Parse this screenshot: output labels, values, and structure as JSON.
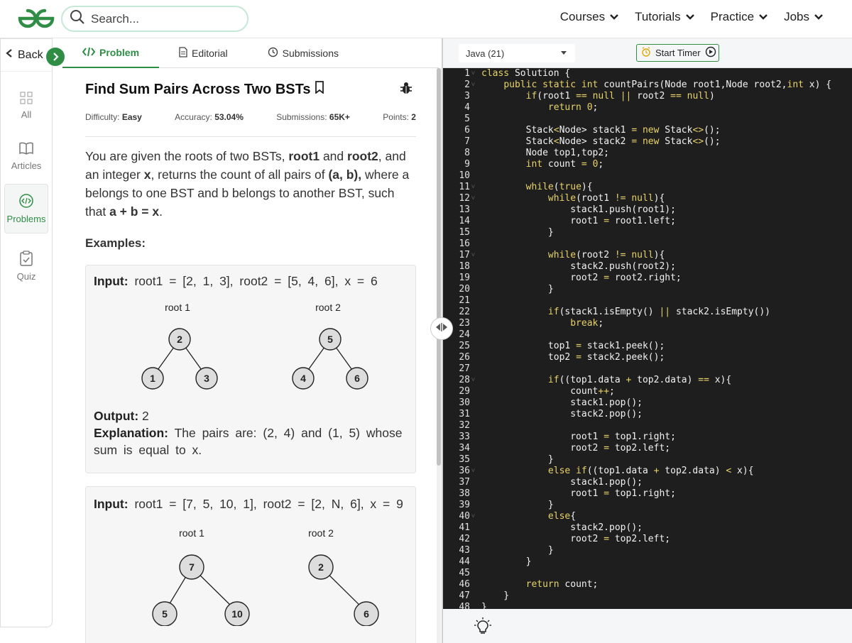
{
  "header": {
    "search_placeholder": "Search...",
    "nav": [
      {
        "label": "Courses"
      },
      {
        "label": "Tutorials"
      },
      {
        "label": "Practice"
      },
      {
        "label": "Jobs"
      }
    ]
  },
  "sidebar": {
    "back_label": "Back",
    "items": [
      {
        "label": "All"
      },
      {
        "label": "Articles"
      },
      {
        "label": "Problems"
      },
      {
        "label": "Quiz"
      }
    ]
  },
  "tabs": [
    {
      "label": "Problem"
    },
    {
      "label": "Editorial"
    },
    {
      "label": "Submissions"
    }
  ],
  "problem": {
    "title": "Find Sum Pairs Across Two BSTs",
    "difficulty_label": "Difficulty:",
    "difficulty": "Easy",
    "accuracy_label": "Accuracy:",
    "accuracy": "53.04%",
    "submissions_label": "Submissions:",
    "submissions": "65K+",
    "points_label": "Points:",
    "points": "2",
    "desc_1": "You are given the roots of two BSTs, ",
    "desc_root1": "root1",
    "desc_2": " and ",
    "desc_root2": "root2",
    "desc_3": ", and an integer ",
    "desc_x": "x",
    "desc_4": ", returns the count of all pairs of ",
    "desc_ab": "(a, b),",
    "desc_5": " where a belongs to one BST and b belongs to another BST, such that ",
    "desc_sum": "a + b = x",
    "desc_6": ".",
    "examples_heading": "Examples:"
  },
  "examples": [
    {
      "input_label": "Input:",
      "input": "root1 = [2, 1, 3], root2 = [5, 4, 6], x = 6",
      "tree1_label": "root 1",
      "tree1": [
        "2",
        "1",
        "3"
      ],
      "tree2_label": "root 2",
      "tree2": [
        "5",
        "4",
        "6"
      ],
      "output_label": "Output:",
      "output": "2",
      "explanation_label": "Explanation:",
      "explanation": "The pairs are: (2, 4) and (1, 5) whose sum is equal to x."
    },
    {
      "input_label": "Input:",
      "input": "root1 = [7, 5, 10, 1], root2 = [2, N, 6], x = 9",
      "tree1_label": "root 1",
      "tree1": [
        "7",
        "5",
        "10"
      ],
      "tree2_label": "root 2",
      "tree2": [
        "2",
        "6"
      ]
    }
  ],
  "editor": {
    "language": "Java (21)",
    "timer_label": "Start Timer",
    "lines": [
      "class Solution {",
      "    public static int countPairs(Node root1,Node root2,int x) {",
      "        if(root1 == null || root2 == null)",
      "            return 0;",
      "",
      "        Stack<Node> stack1 = new Stack<>();",
      "        Stack<Node> stack2 = new Stack<>();",
      "        Node top1,top2;",
      "        int count = 0;",
      "",
      "        while(true){",
      "            while(root1 != null){",
      "                stack1.push(root1);",
      "                root1 = root1.left;",
      "            }",
      "",
      "            while(root2 != null){",
      "                stack2.push(root2);",
      "                root2 = root2.right;",
      "            }",
      "",
      "            if(stack1.isEmpty() || stack2.isEmpty())",
      "                break;",
      "",
      "            top1 = stack1.peek();",
      "            top2 = stack2.peek();",
      "",
      "            if((top1.data + top2.data) == x){",
      "                count++;",
      "                stack1.pop();",
      "                stack2.pop();",
      "",
      "                root1 = top1.right;",
      "                root2 = top2.left;",
      "            }",
      "            else if((top1.data + top2.data) < x){",
      "                stack1.pop();",
      "                root1 = top1.right;",
      "            }",
      "            else{",
      "                stack2.pop();",
      "                root2 = top2.left;",
      "            }",
      "        }",
      "",
      "        return count;",
      "    }",
      "}"
    ],
    "fold_lines": [
      1,
      2,
      11,
      12,
      17,
      28,
      36,
      40
    ]
  },
  "colors": {
    "accent": "#2f8d46",
    "editor_bg": "#1e1e1e",
    "keyword": "#e8d26a"
  }
}
